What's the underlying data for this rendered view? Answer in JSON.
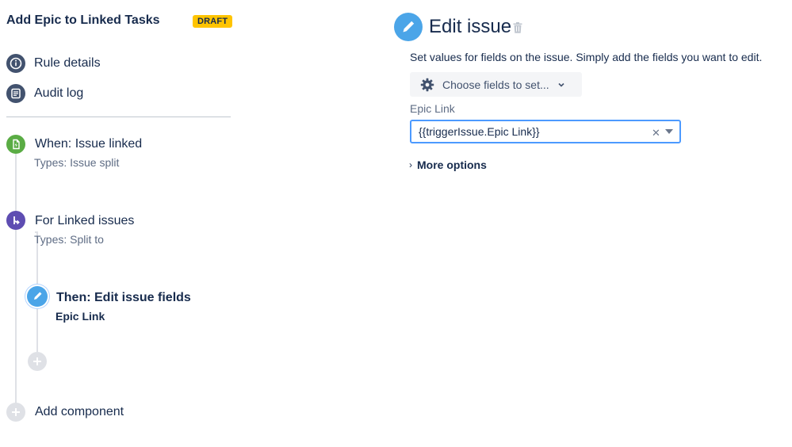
{
  "rule": {
    "title": "Add Epic to Linked Tasks",
    "status_badge": "DRAFT"
  },
  "nav": [
    {
      "label": "Rule details",
      "icon": "info-icon"
    },
    {
      "label": "Audit log",
      "icon": "list-icon"
    }
  ],
  "steps": {
    "trigger": {
      "title": "When: Issue linked",
      "subtitle": "Types: Issue split",
      "icon": "trigger-icon"
    },
    "branch": {
      "title": "For Linked issues",
      "subtitle": "Types: Split to",
      "icon": "branch-icon"
    },
    "action": {
      "title": "Then: Edit issue fields",
      "subtitle": "Epic Link",
      "icon": "pencil-icon"
    },
    "add_component_label": "Add component"
  },
  "editor": {
    "title": "Edit issue",
    "description": "Set values for fields on the issue. Simply add the fields you want to edit.",
    "choose_fields_label": "Choose fields to set...",
    "field": {
      "label": "Epic Link",
      "value": "{{triggerIssue.Epic Link}}"
    },
    "more_options_label": "More options"
  },
  "colors": {
    "badge": "#ffc400",
    "trigger": "#5aac44",
    "branch": "#5e4db2",
    "action": "#4ba5e8",
    "nav_icon": "#42526e",
    "add": "#dfe1e6",
    "input_focus": "#4c9aff"
  }
}
